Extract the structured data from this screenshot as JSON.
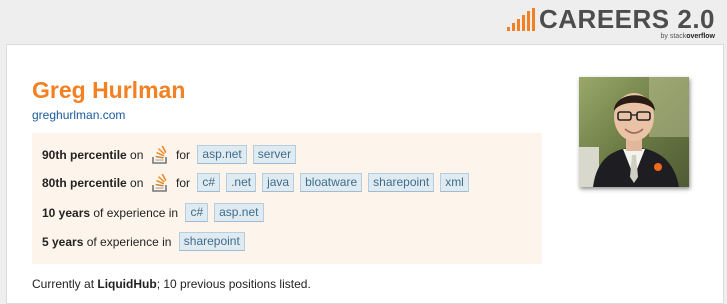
{
  "brand": {
    "title": "CAREERS 2.0",
    "sub_prefix": "by stack",
    "sub_bold": "overflow",
    "accent_color": "#f48024"
  },
  "profile": {
    "name": "Greg Hurlman",
    "website": "greghurlman.com",
    "avatar_icon": "user-photo"
  },
  "stats": [
    {
      "bold": "90th percentile",
      "mid": " on ",
      "icon": "stackoverflow-icon",
      "after": " for ",
      "tags": [
        "asp.net",
        "server"
      ]
    },
    {
      "bold": "80th percentile",
      "mid": " on ",
      "icon": "stackoverflow-icon",
      "after": " for ",
      "tags": [
        "c#",
        ".net",
        "java",
        "bloatware",
        "sharepoint",
        "xml"
      ]
    },
    {
      "bold": "10 years",
      "mid": " of experience in ",
      "tags": [
        "c#",
        "asp.net"
      ]
    },
    {
      "bold": "5 years",
      "mid": " of experience in ",
      "tags": [
        "sharepoint"
      ]
    }
  ],
  "current": {
    "prefix": "Currently at ",
    "company": "LiquidHub",
    "suffix": "; 10 previous positions listed."
  }
}
